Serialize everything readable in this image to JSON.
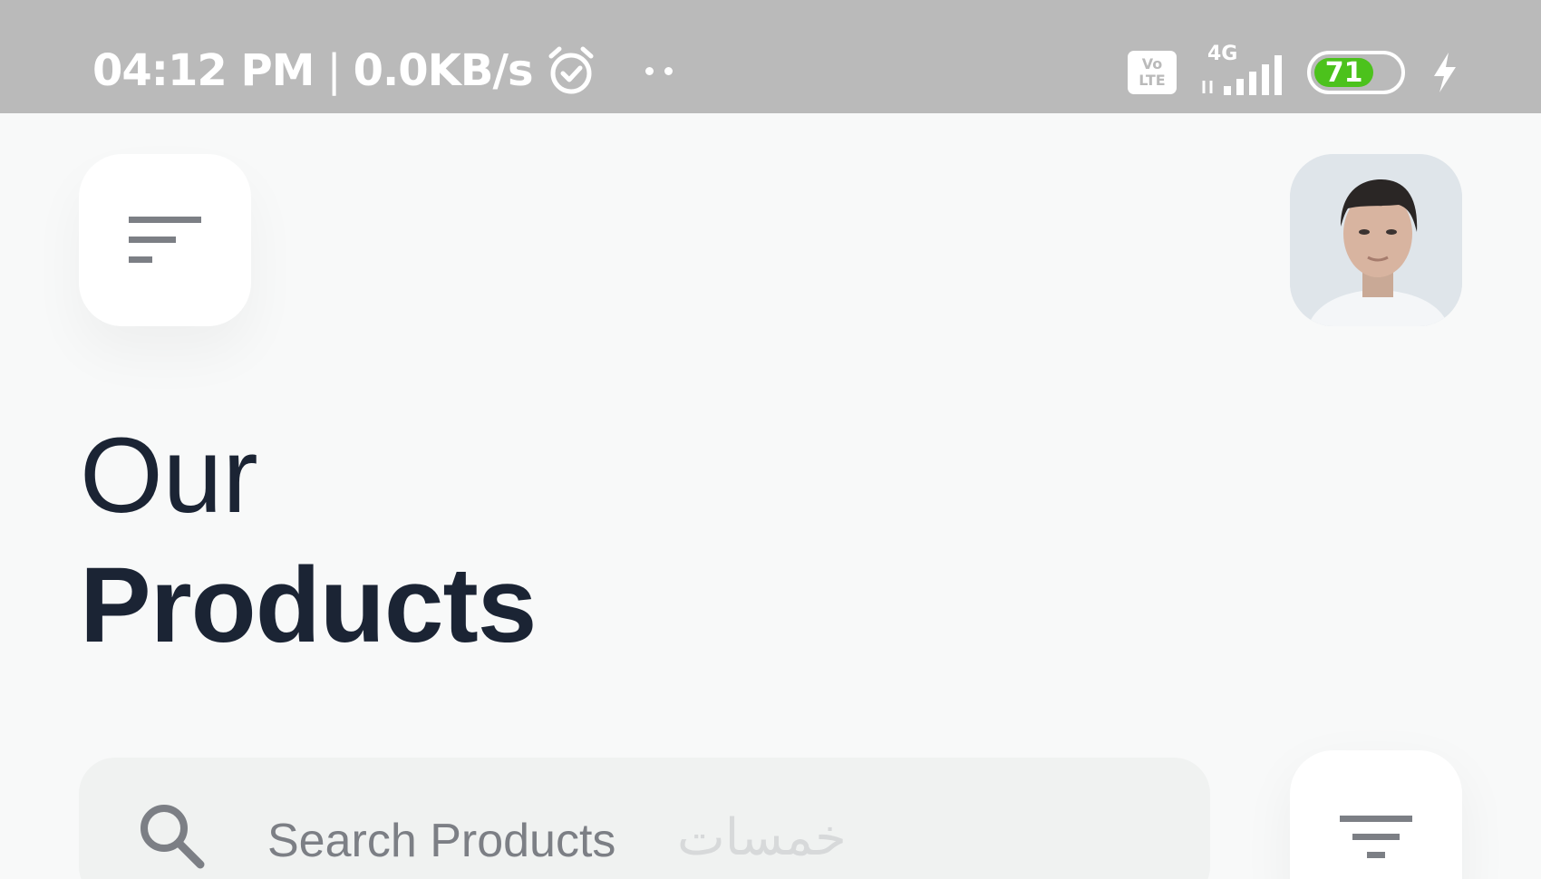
{
  "status_bar": {
    "time": "04:12 PM",
    "separator": "|",
    "net_speed": "0.0KB/s",
    "volte_top": "Vo",
    "volte_bottom": "LTE",
    "network": "4G",
    "battery_level": "71",
    "battery_fraction": 0.71,
    "accent_battery": "#4cc21c"
  },
  "header": {
    "menu_icon": "sort-lines-icon",
    "avatar": "user-avatar"
  },
  "title": {
    "line1": "Our",
    "line2": "Products"
  },
  "search": {
    "icon": "search-icon",
    "placeholder": "Search Products",
    "watermark": "خمسات"
  },
  "filter": {
    "icon": "filter-icon"
  },
  "colors": {
    "background": "#f8f9f9",
    "status_bar": "#bababa",
    "title": "#1b2434",
    "search_bg": "#f0f2f1",
    "placeholder": "#7c7f85"
  }
}
